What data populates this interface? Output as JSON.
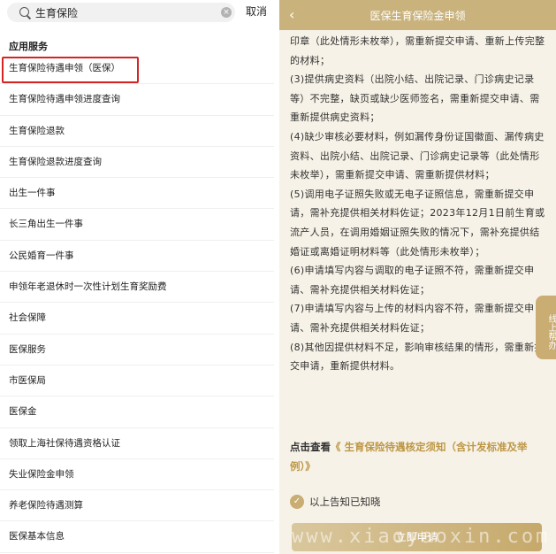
{
  "search": {
    "value": "生育保险",
    "clear_icon": "×",
    "cancel_label": "取消"
  },
  "results": {
    "section_title": "应用服务",
    "items": [
      {
        "label": "生育保险待遇申领（医保）",
        "highlighted": true
      },
      {
        "label": "生育保险待遇申领进度查询"
      },
      {
        "label": "生育保险退款"
      },
      {
        "label": "生育保险退款进度查询"
      },
      {
        "label": "出生一件事"
      },
      {
        "label": "长三角出生一件事"
      },
      {
        "label": "公民婚育一件事"
      },
      {
        "label": "申领年老退休时一次性计划生育奖励费"
      },
      {
        "label": "社会保障"
      },
      {
        "label": "医保服务"
      },
      {
        "label": "市医保局"
      },
      {
        "label": "医保金"
      },
      {
        "label": "领取上海社保待遇资格认证"
      },
      {
        "label": "失业保险金申领"
      },
      {
        "label": "养老保险待遇测算"
      },
      {
        "label": "医保基本信息"
      }
    ]
  },
  "detail": {
    "back_icon": "‹",
    "title": "医保生育保险金申领",
    "paragraphs": [
      "印章（此处情形未枚举），需重新提交申请、重新上传完整的材料；",
      "(3)提供病史资料（出院小结、出院记录、门诊病史记录等）不完整，缺页或缺少医师签名，需重新提交申请、需重新提供病史资料；",
      "(4)缺少审核必要材料，例如漏传身份证国徽面、漏传病史资料、出院小结、出院记录、门诊病史记录等（此处情形未枚举），需重新提交申请、需重新提供材料；",
      "(5)调用电子证照失败或无电子证照信息，需重新提交申请，需补充提供相关材料佐证；2023年12月1日前生育或流产人员，在调用婚姻证照失败的情况下，需补充提供结婚证或离婚证明材料等（此处情形未枚举）；",
      "(6)申请填写内容与调取的电子证照不符，需重新提交申请、需补充提供相关材料佐证；",
      "(7)申请填写内容与上传的材料内容不符，需重新提交申请、需补充提供相关材料佐证；",
      "(8)其他因提供材料不足，影响审核结果的情形，需重新提交申请，重新提供材料。"
    ],
    "notice_lead": "点击查看",
    "notice_link": "《 生育保险待遇核定须知（含计发标准及举例）》",
    "check_icon": "✓",
    "agree_text": "以上告知已知晓",
    "apply_label": "立即申请",
    "help_tab": "线上帮办"
  },
  "watermark": "www.xiaoyaoxin.com",
  "colors": {
    "header": "#c9b27c",
    "link": "#bd9645",
    "highlight_border": "#d42424",
    "detail_background": "#f7f2e7"
  }
}
